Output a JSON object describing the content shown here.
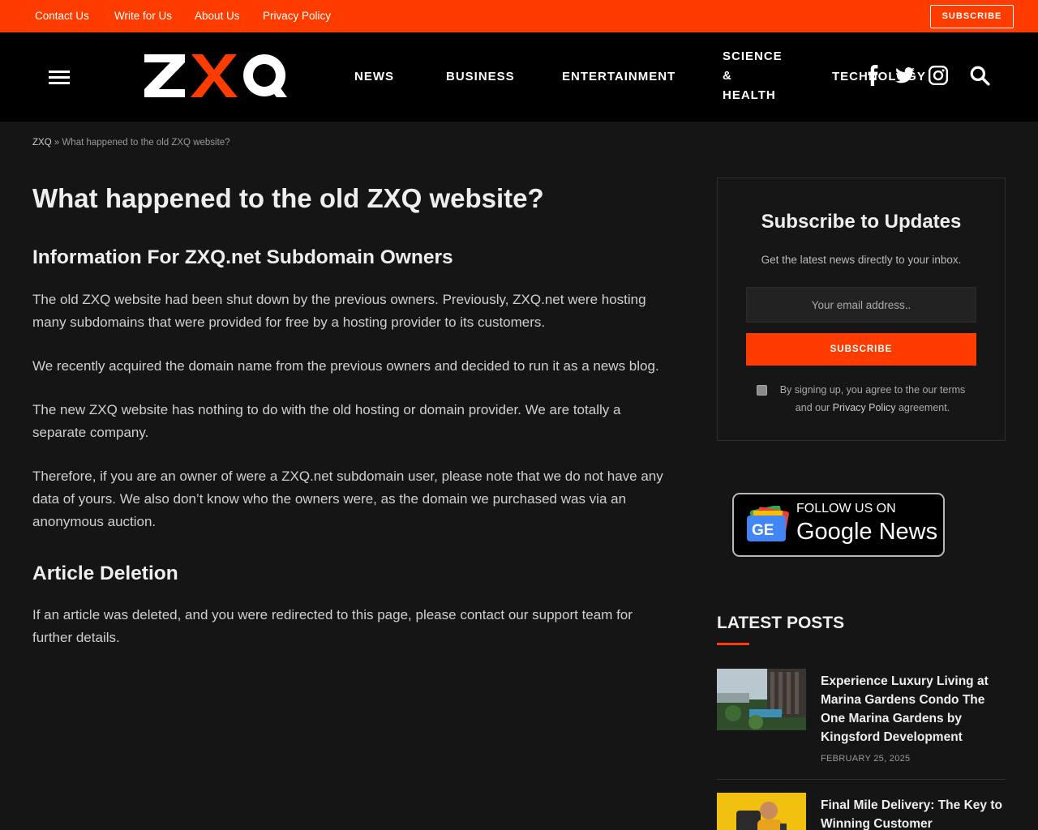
{
  "topbar": {
    "links": [
      "Contact Us",
      "Write for Us",
      "About Us",
      "Privacy Policy"
    ],
    "subscribe_label": "SUBSCRIBE",
    "accent_color": "#ff3c00"
  },
  "header": {
    "logo_text": "ZXQ",
    "nav": [
      "NEWS",
      "BUSINESS",
      "ENTERTAINMENT",
      "SCIENCE & HEALTH",
      "TECHNOLOGY"
    ],
    "icons": [
      "menu-icon",
      "facebook-icon",
      "twitter-icon",
      "instagram-icon",
      "search-icon"
    ]
  },
  "breadcrumb": {
    "home": "ZXQ",
    "sep": "»",
    "current": "What happened to the old ZXQ website?"
  },
  "article": {
    "title": "What happened to the old ZXQ website?",
    "h2_owners": "Information For ZXQ.net Subdomain Owners",
    "p1": "The old ZXQ website had been shut down by the previous owners. Previously, ZXQ.net were hosting many subdomains that were provided for free by a hosting provider to its customers.",
    "p2": "We recently acquired the domain name from the previous owners and decided to run it as a news blog.",
    "p3": "The new ZXQ website has nothing to do with the old hosting or domain provider. We are totally a separate company.",
    "p4": "Therefore, if you are an owner of were a ZXQ.net subdomain user, please note that we do not have any data of yours. We also don’t know who the owners were, as the domain we purchased was via an anonymous auction.",
    "h2_deletion": "Article Deletion",
    "p5": "If an article was deleted, and you were redirected to this page, please contact our support team for further details."
  },
  "subscribe": {
    "title": "Subscribe to Updates",
    "desc": "Get the latest news directly to your inbox.",
    "placeholder": "Your email address..",
    "button": "SUBSCRIBE",
    "agree_pre": "By signing up, you agree to the our terms and our ",
    "agree_link": "Privacy Policy",
    "agree_post": " agreement."
  },
  "gnews": {
    "line1": "FOLLOW US ON",
    "line2": "Google News"
  },
  "latest": {
    "title": "LATEST POSTS",
    "posts": [
      {
        "title": "Experience Luxury Living at Marina Gardens Condo The One Marina Gardens by Kingsford Development",
        "date": "FEBRUARY 25, 2025"
      },
      {
        "title": "Final Mile Delivery: The Key to Winning Customer",
        "date": ""
      }
    ]
  }
}
